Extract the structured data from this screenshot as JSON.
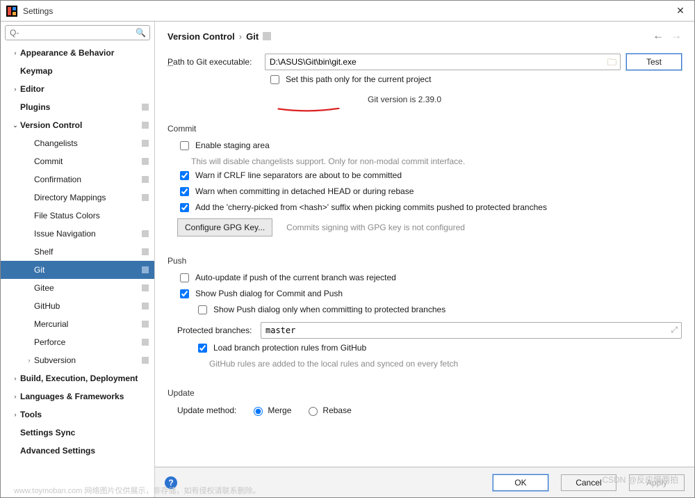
{
  "window": {
    "title": "Settings"
  },
  "search": {
    "placeholder": "Q-"
  },
  "sidebar": [
    {
      "label": "Appearance & Behavior",
      "bold": true,
      "indent": 1,
      "arrow": "›"
    },
    {
      "label": "Keymap",
      "bold": true,
      "indent": 1
    },
    {
      "label": "Editor",
      "bold": true,
      "indent": 1,
      "arrow": "›"
    },
    {
      "label": "Plugins",
      "bold": true,
      "indent": 1,
      "badge": true
    },
    {
      "label": "Version Control",
      "bold": true,
      "indent": 1,
      "arrow": "⌄",
      "badge": true
    },
    {
      "label": "Changelists",
      "indent": 2,
      "badge": true
    },
    {
      "label": "Commit",
      "indent": 2,
      "badge": true
    },
    {
      "label": "Confirmation",
      "indent": 2,
      "badge": true
    },
    {
      "label": "Directory Mappings",
      "indent": 2,
      "badge": true
    },
    {
      "label": "File Status Colors",
      "indent": 2
    },
    {
      "label": "Issue Navigation",
      "indent": 2,
      "badge": true
    },
    {
      "label": "Shelf",
      "indent": 2,
      "badge": true
    },
    {
      "label": "Git",
      "indent": 2,
      "badge": true,
      "selected": true
    },
    {
      "label": "Gitee",
      "indent": 2,
      "badge": true
    },
    {
      "label": "GitHub",
      "indent": 2,
      "badge": true
    },
    {
      "label": "Mercurial",
      "indent": 2,
      "badge": true
    },
    {
      "label": "Perforce",
      "indent": 2,
      "badge": true
    },
    {
      "label": "Subversion",
      "indent": 2,
      "arrow": "›",
      "badge": true
    },
    {
      "label": "Build, Execution, Deployment",
      "bold": true,
      "indent": 1,
      "arrow": "›"
    },
    {
      "label": "Languages & Frameworks",
      "bold": true,
      "indent": 1,
      "arrow": "›"
    },
    {
      "label": "Tools",
      "bold": true,
      "indent": 1,
      "arrow": "›"
    },
    {
      "label": "Settings Sync",
      "bold": true,
      "indent": 1
    },
    {
      "label": "Advanced Settings",
      "bold": true,
      "indent": 1
    }
  ],
  "breadcrumb": {
    "root": "Version Control",
    "leaf": "Git",
    "sep": "›"
  },
  "pathLabel": "Path to Git executable:",
  "pathLabelPrefix": "P",
  "pathValue": "D:\\ASUS\\Git\\bin\\git.exe",
  "testBtn": "Test",
  "setPathOnly": "Set this path only for the current project",
  "gitVersion": "Git version is 2.39.0",
  "sections": {
    "commit": {
      "title": "Commit",
      "enableStaging": "Enable staging area",
      "stagingNote": "This will disable changelists support. Only for non-modal commit interface.",
      "warnCRLF": "Warn if CRLF line separators are about to be committed",
      "warnDetached": "Warn when committing in detached HEAD or during rebase",
      "cherryPick": "Add the 'cherry-picked from <hash>' suffix when picking commits pushed to protected branches",
      "gpgBtn": "Configure GPG Key...",
      "gpgNote": "Commits signing with GPG key is not configured"
    },
    "push": {
      "title": "Push",
      "autoUpdate": "Auto-update if push of the current branch was rejected",
      "showPush": "Show Push dialog for Commit and Push",
      "showPushProtected": "Show Push dialog only when committing to protected branches",
      "protectedLabel": "Protected branches:",
      "protectedValue": "master",
      "loadRules": "Load branch protection rules from GitHub",
      "rulesNote": "GitHub rules are added to the local rules and synced on every fetch"
    },
    "update": {
      "title": "Update",
      "methodLabel": "Update method:",
      "merge": "Merge",
      "rebase": "Rebase"
    }
  },
  "buttons": {
    "ok": "OK",
    "cancel": "Cancel",
    "apply": "Apply"
  },
  "watermark": "www.toymoban.com  网络图片仅供展示，非存储，如有侵权请联系删除。",
  "watermark2": "CSDN @反应慢两拍"
}
